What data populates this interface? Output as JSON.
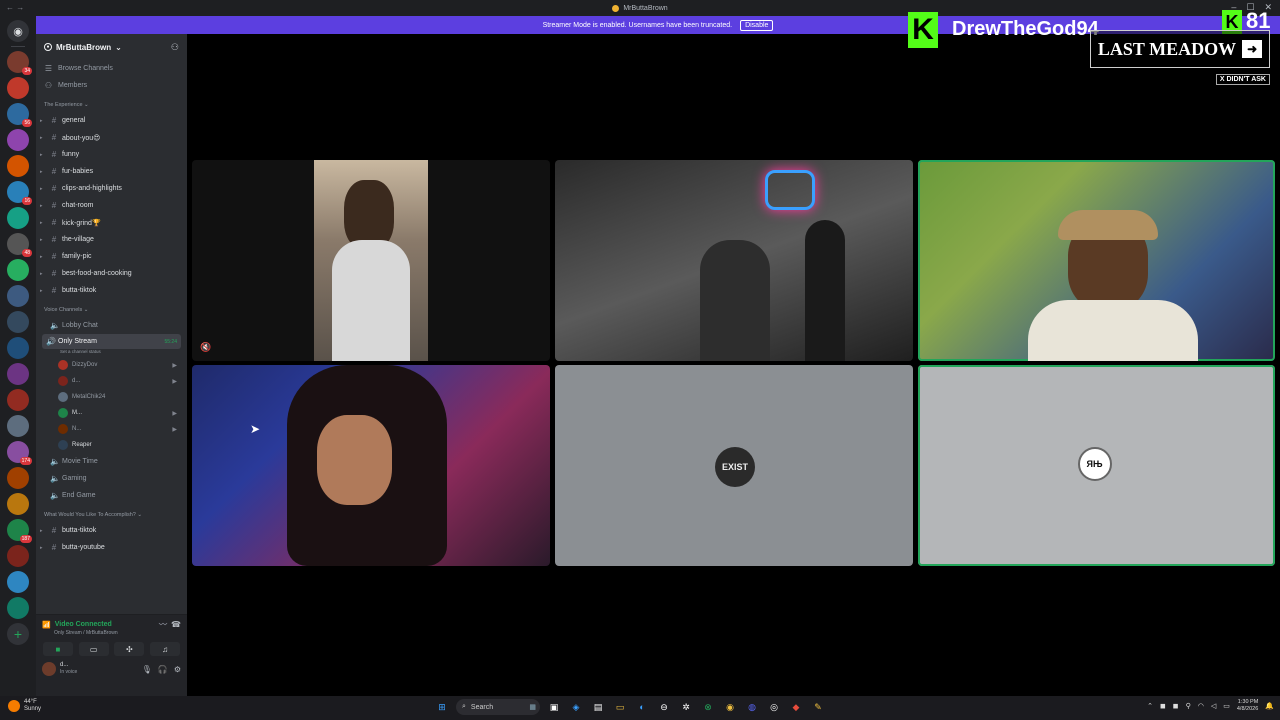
{
  "window": {
    "title": "MrButtaBrown"
  },
  "banner": {
    "text": "Streamer Mode is enabled. Usernames have been truncated.",
    "button": "Disable"
  },
  "rail": {
    "badges": [
      "34",
      "56",
      "16",
      "48",
      "174",
      "187"
    ]
  },
  "server": {
    "name": "MrButtaBrown"
  },
  "nav": {
    "browse": "Browse Channels",
    "members": "Members"
  },
  "categories": {
    "experience": "The Experience",
    "voice": "Voice Channels",
    "accomplish": "What Would You Like To Accomplish?"
  },
  "text_channels": [
    {
      "name": "general"
    },
    {
      "name": "about-you😍"
    },
    {
      "name": "funny"
    },
    {
      "name": "fur-babies"
    },
    {
      "name": "clips-and-highlights"
    },
    {
      "name": "chat-room"
    },
    {
      "name": "kick-grind🏆"
    },
    {
      "name": "the-village"
    },
    {
      "name": "family-pic"
    },
    {
      "name": "best-food-and-cooking"
    },
    {
      "name": "butta-tiktok"
    }
  ],
  "voice_channels": {
    "lobby": "Lobby Chat",
    "active": {
      "name": "Only Stream",
      "timer": "55:24",
      "status": "Set a channel status"
    },
    "users": [
      "DizzyDov",
      "d...",
      "MetalChik24",
      "M...",
      "N...",
      "Reaper"
    ],
    "others": [
      "Movie Time",
      "Gaming",
      "End Game"
    ]
  },
  "accomplish_channels": [
    {
      "name": "butta-tiktok"
    },
    {
      "name": "butta-youtube"
    }
  ],
  "voice_panel": {
    "status": "Video Connected",
    "sub": "Only Stream / MrButtaBrown",
    "user_name": "d...",
    "user_status": "In voice"
  },
  "tiles": {
    "t5_label": "EXIST",
    "t6_label": "ЯЊ"
  },
  "overlay": {
    "logo": "K",
    "streamer": "DrewTheGod94",
    "viewer_logo": "K",
    "viewer_count": "81",
    "song": "LAST MEADOW",
    "tag": "X DIDN'T ASK"
  },
  "taskbar": {
    "temp": "44°F",
    "weather": "Sunny",
    "search": "Search",
    "time": "1:30 PM",
    "date": "4/8/2026"
  }
}
